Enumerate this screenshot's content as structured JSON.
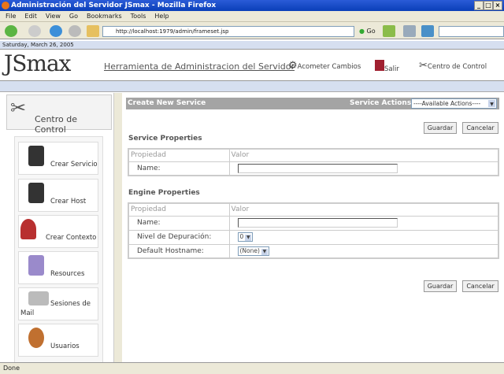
{
  "window": {
    "title": "Administración del Servidor JSmax - Mozilla Firefox"
  },
  "menu": [
    "File",
    "Edit",
    "View",
    "Go",
    "Bookmarks",
    "Tools",
    "Help"
  ],
  "toolbar": {
    "url": "http://localhost:1979/admin/frameset.jsp",
    "go_label": "Go",
    "search_placeholder": ""
  },
  "header": {
    "date": "Saturday, March 26, 2005",
    "logo": "JSmax",
    "title": "Herramienta de Administracion del Servidor",
    "links": [
      "Acometer Cambios",
      "Salir",
      "Centro de Control"
    ]
  },
  "sidebar": {
    "title": "Centro de Control",
    "items": [
      {
        "label": "Crear Servicio",
        "color": "#333333"
      },
      {
        "label": "Crear Host",
        "color": "#333333"
      },
      {
        "label": "Crear Contexto",
        "color": "#b83030"
      },
      {
        "label": "Resources",
        "color": "#9a8acb"
      },
      {
        "label": "Sesiones de Mail",
        "color": "#aaaaaa"
      },
      {
        "label": "Usuarios",
        "color": "#c07030"
      }
    ]
  },
  "main": {
    "title": "Create New Service",
    "actions_label": "Service Actions",
    "actions_value": "----Available Actions----",
    "save": "Guardar",
    "cancel": "Cancelar",
    "service": {
      "heading": "Service Properties",
      "col1": "Propiedad",
      "col2": "Valor",
      "rows": [
        {
          "label": "Name:",
          "value": ""
        }
      ]
    },
    "engine": {
      "heading": "Engine Properties",
      "col1": "Propiedad",
      "col2": "Valor",
      "name_label": "Name:",
      "name_value": "",
      "debug_label": "Nivel de Depuración:",
      "debug_value": "0",
      "host_label": "Default Hostname:",
      "host_value": "(None)"
    }
  },
  "status": "Done"
}
